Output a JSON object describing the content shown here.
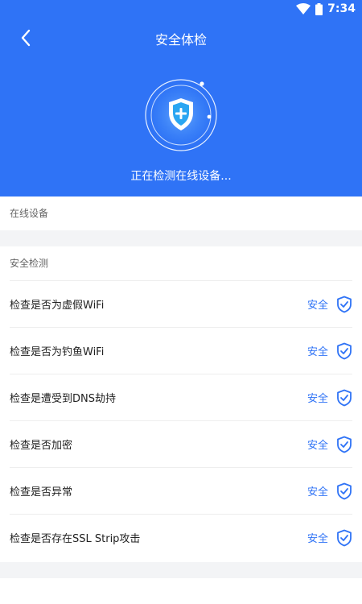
{
  "status_bar": {
    "time": "7:34"
  },
  "nav": {
    "title": "安全体检"
  },
  "scan": {
    "status_text": "正在检测在线设备..."
  },
  "online_section": {
    "label": "在线设备"
  },
  "security_section": {
    "label": "安全检测",
    "items": [
      {
        "label": "检查是否为虚假WiFi",
        "status": "安全"
      },
      {
        "label": "检查是否为钓鱼WiFi",
        "status": "安全"
      },
      {
        "label": "检查是遭受到DNS劫持",
        "status": "安全"
      },
      {
        "label": "检查是否加密",
        "status": "安全"
      },
      {
        "label": "检查是否异常",
        "status": "安全"
      },
      {
        "label": "检查是否存在SSL Strip攻击",
        "status": "安全"
      }
    ]
  },
  "colors": {
    "brand": "#2f73f6",
    "background": "#f3f4f6"
  }
}
